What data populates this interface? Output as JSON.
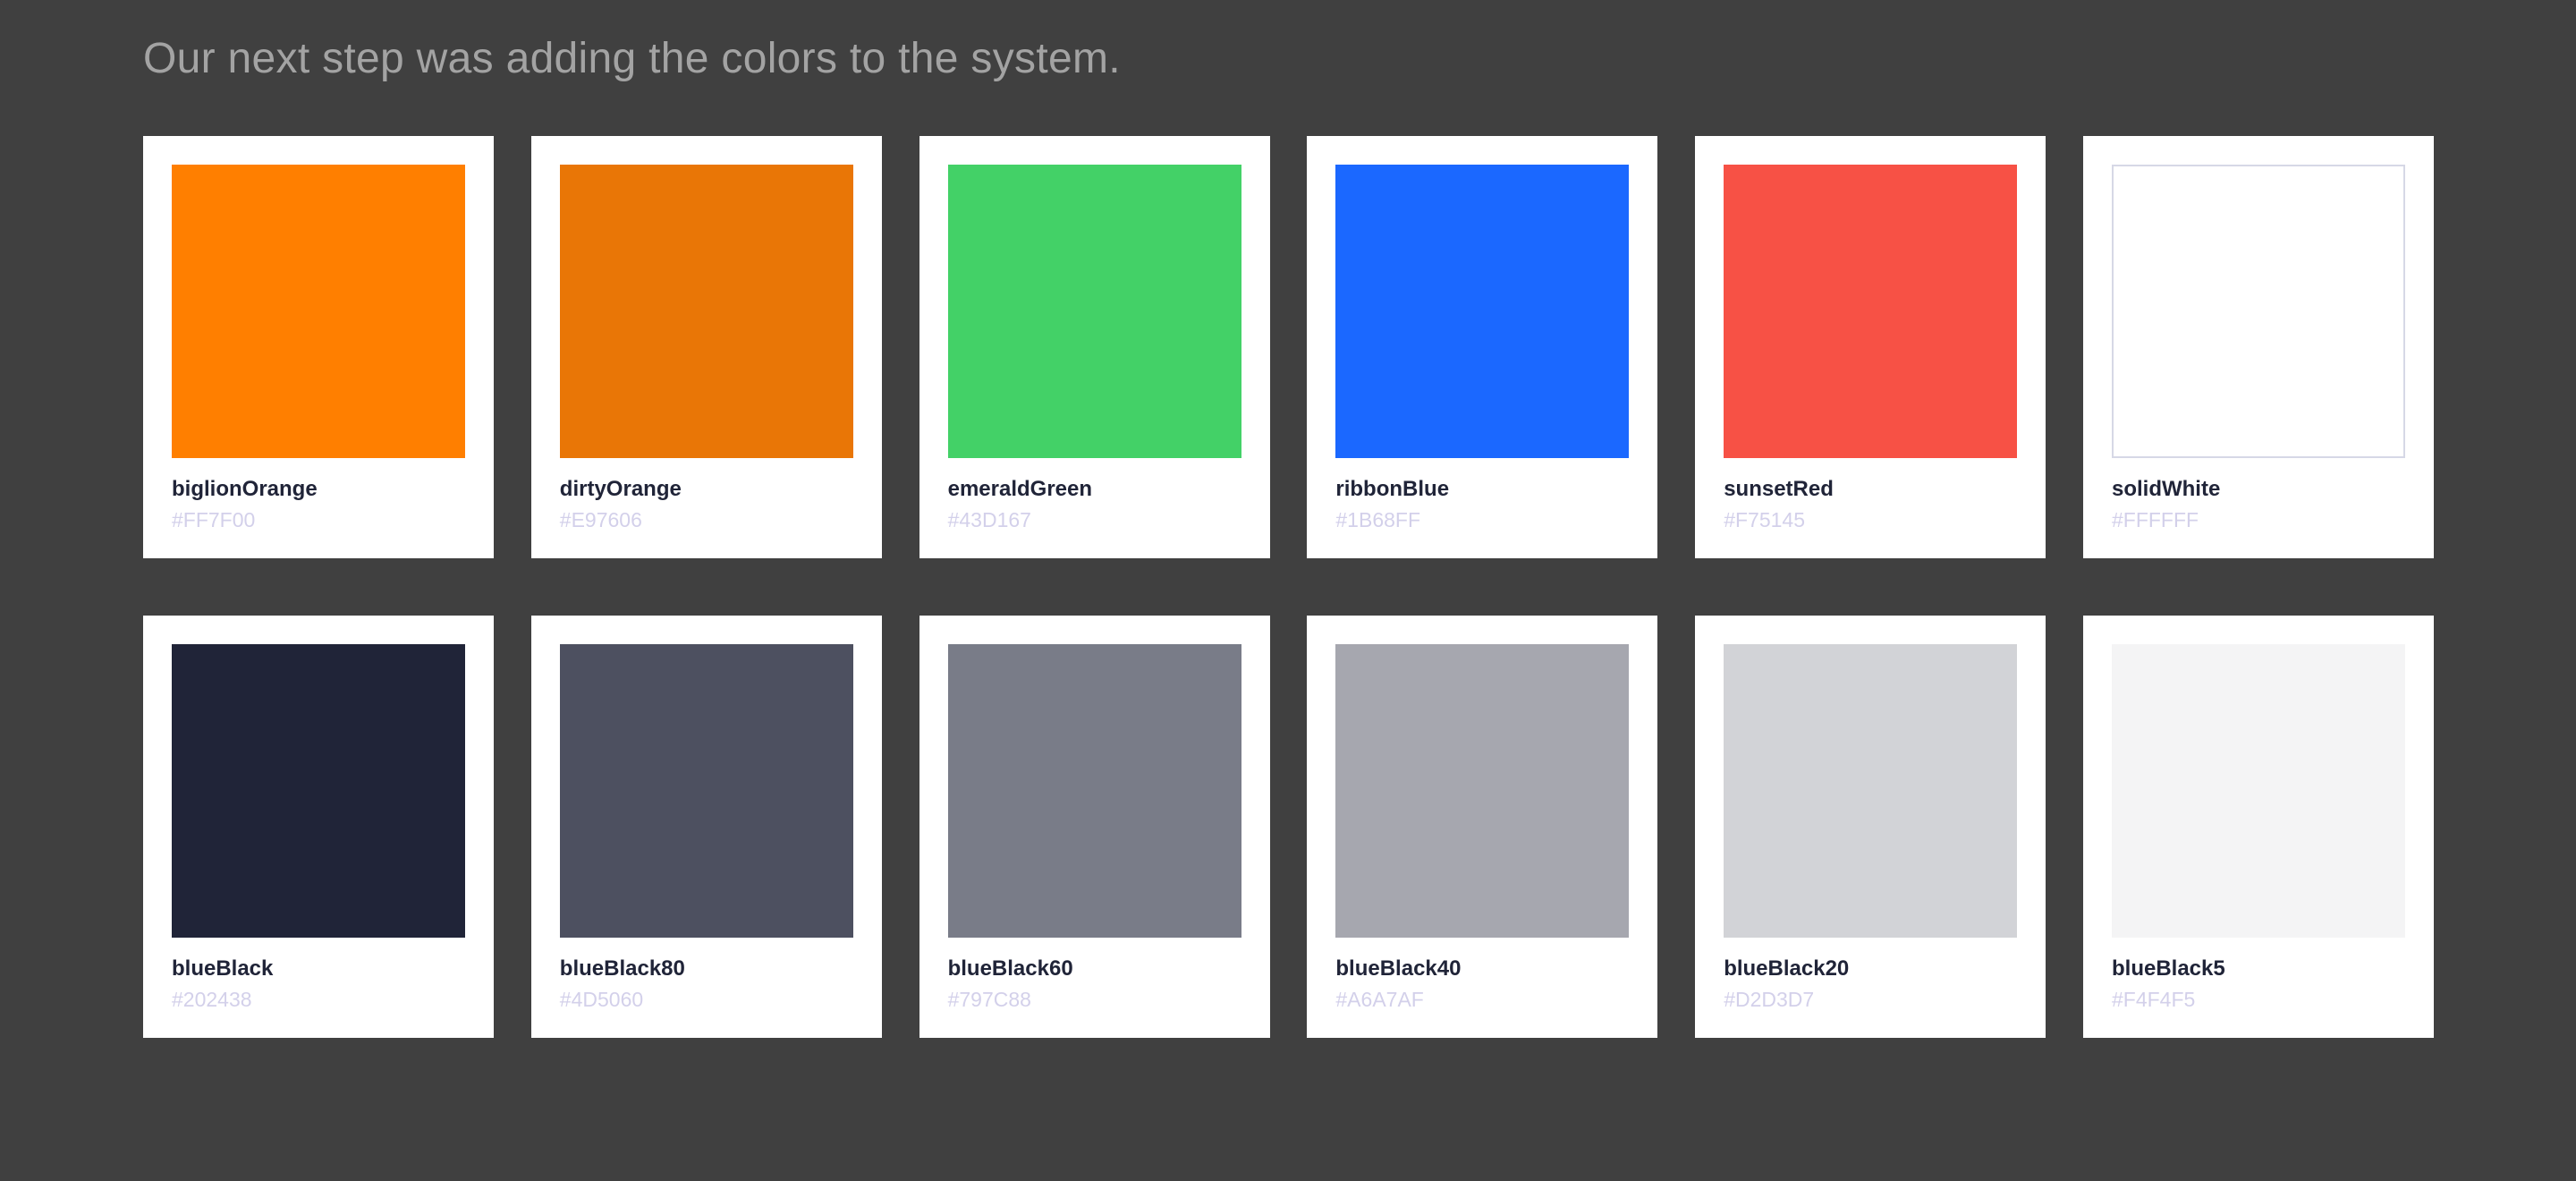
{
  "heading": "Our next step was adding the colors to the system.",
  "swatches": [
    {
      "name": "biglionOrange",
      "hex": "#FF7F00",
      "color": "#FF7F00",
      "outlined": false
    },
    {
      "name": "dirtyOrange",
      "hex": "#E97606",
      "color": "#E97606",
      "outlined": false
    },
    {
      "name": "emeraldGreen",
      "hex": "#43D167",
      "color": "#43D167",
      "outlined": false
    },
    {
      "name": "ribbonBlue",
      "hex": "#1B68FF",
      "color": "#1B68FF",
      "outlined": false
    },
    {
      "name": "sunsetRed",
      "hex": "#F75145",
      "color": "#F75145",
      "outlined": false
    },
    {
      "name": "solidWhite",
      "hex": "#FFFFFF",
      "color": "#FFFFFF",
      "outlined": true
    },
    {
      "name": "blueBlack",
      "hex": "#202438",
      "color": "#202438",
      "outlined": false
    },
    {
      "name": "blueBlack80",
      "hex": "#4D5060",
      "color": "#4D5060",
      "outlined": false
    },
    {
      "name": "blueBlack60",
      "hex": "#797C88",
      "color": "#797C88",
      "outlined": false
    },
    {
      "name": "blueBlack40",
      "hex": "#A6A7AF",
      "color": "#A6A7AF",
      "outlined": false
    },
    {
      "name": "blueBlack20",
      "hex": "#D2D3D7",
      "color": "#D2D3D7",
      "outlined": false
    },
    {
      "name": "blueBlack5",
      "hex": "#F4F4F5",
      "color": "#F4F4F5",
      "outlined": false
    }
  ]
}
